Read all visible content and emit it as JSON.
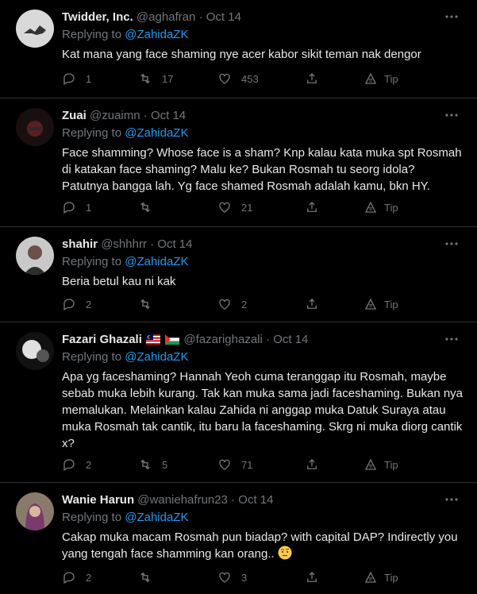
{
  "colors": {
    "background": "#000000",
    "text": "#e7e9ea",
    "muted": "#71767b",
    "link": "#1d9bf0",
    "divider": "#2f3336"
  },
  "tweets": [
    {
      "name": "Twidder, Inc.",
      "handle": "@aghafran",
      "dot": "·",
      "date": "Oct 14",
      "replying_prefix": "Replying to ",
      "replying_to": "@ZahidaZK",
      "text": "Kat mana yang face shaming nye acer kabor sikit teman nak dengor",
      "replies": "1",
      "retweets": "17",
      "likes": "453",
      "tip": "Tip"
    },
    {
      "name": "Zuai",
      "handle": "@zuaimn",
      "dot": "·",
      "date": "Oct 14",
      "replying_prefix": "Replying to ",
      "replying_to": "@ZahidaZK",
      "text": "Face shamming? Whose face is a sham? Knp kalau kata muka spt Rosmah di katakan face shaming? Malu ke? Bukan Rosmah tu seorg idola? Patutnya bangga lah. Yg face shamed Rosmah adalah kamu, bkn HY.",
      "replies": "1",
      "retweets": "",
      "likes": "21",
      "tip": "Tip"
    },
    {
      "name": "shahir",
      "handle": "@shhhrr",
      "dot": "·",
      "date": "Oct 14",
      "replying_prefix": "Replying to ",
      "replying_to": "@ZahidaZK",
      "text": "Beria betul kau ni kak",
      "replies": "2",
      "retweets": "",
      "likes": "2",
      "tip": "Tip"
    },
    {
      "name": "Fazari Ghazali",
      "handle": "@fazarighazali",
      "dot": "·",
      "date": "Oct 14",
      "replying_prefix": "Replying to ",
      "replying_to": "@ZahidaZK",
      "text": "Apa yg faceshaming? Hannah Yeoh cuma teranggap itu Rosmah, maybe sebab muka lebih kurang. Tak kan muka sama jadi faceshaming. Bukan nya memalukan. Melainkan kalau Zahida ni anggap muka Datuk Suraya atau muka Rosmah tak cantik, itu baru la faceshaming. Skrg ni muka diorg cantik x?",
      "replies": "2",
      "retweets": "5",
      "likes": "71",
      "tip": "Tip"
    },
    {
      "name": "Wanie Harun",
      "handle": "@waniehafrun23",
      "dot": "·",
      "date": "Oct 14",
      "replying_prefix": "Replying to ",
      "replying_to": "@ZahidaZK",
      "text": "Cakap muka macam Rosmah pun biadap? with capital DAP? Indirectly you yang tengah face shamming kan orang..",
      "replies": "2",
      "retweets": "",
      "likes": "3",
      "tip": "Tip"
    }
  ]
}
